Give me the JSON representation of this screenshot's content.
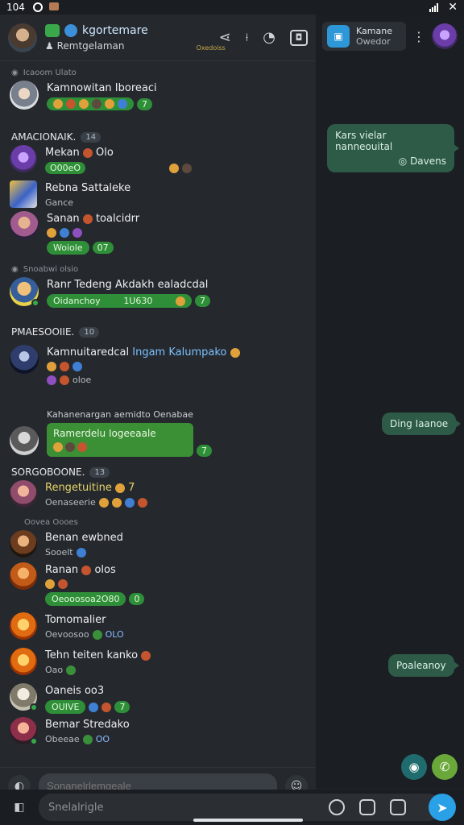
{
  "status": {
    "time": "104"
  },
  "header": {
    "title": "kgortemare",
    "subtitle": "Remtgelaman",
    "badge": "Oxedoiss"
  },
  "right_header": {
    "title": "Kamane",
    "subtitle": "Owedor"
  },
  "sections": {
    "pinned": "Icaoom Ulato",
    "a": "AMACIONAIK.",
    "a_count": "14",
    "pinned2": "Snoabwi olsio",
    "b": "PMAESOOIIE.",
    "b_count": "10",
    "c": "SORGOBOONE.",
    "c_count": "13",
    "members_online": "Oovea Oooes"
  },
  "rows": [
    {
      "name": "Kamnowitan Iboreaci",
      "chip": "7",
      "chip_text": "",
      "meta": ""
    },
    {
      "name": "Mekan",
      "name2": "Olo",
      "meta": "O00eO"
    },
    {
      "name": "Rebna Sattaleke",
      "meta": "Gance"
    },
    {
      "name": "Sanan",
      "name2": "toalcidrr",
      "chip": "07",
      "chip_text": "Woiole"
    },
    {
      "name": "Ranr Tedeng Akdakh ealadcdal",
      "chip": "7",
      "chip_text": "Oidanchoy",
      "chip_extra": "1U630"
    },
    {
      "name": "Kamnuitaredcal",
      "name_blue": "Ingam Kalumpako",
      "meta": "oloe"
    },
    {
      "name": "Kahanenargan aemidto Oenabae",
      "bubble": "Ramerdelu Iogeeaale",
      "chip": "7"
    },
    {
      "name": "Rengetuitine",
      "name2": "7",
      "meta": "Oenaseerie"
    },
    {
      "name": "Benan ewbned",
      "meta": "Sooelt"
    },
    {
      "name": "Ranan",
      "name2": "olos",
      "chip_text": "Oeooosoa2O80",
      "chip": "0"
    },
    {
      "name": "Tomomalier",
      "meta": "Oevoosoo",
      "meta2": "OLO"
    },
    {
      "name": "Tehn teiten kanko",
      "meta": "Oao"
    },
    {
      "name": "Oaneis oo3",
      "chip_text": "OUIVE",
      "chip": "7"
    },
    {
      "name": "Bemar Stredako",
      "meta": "Obeeae",
      "meta2": "OO"
    }
  ],
  "composer": {
    "placeholder": "Sonanelrlemgeale"
  },
  "bottom_input": {
    "placeholder": "Snelalrigle"
  },
  "right_bubbles": [
    {
      "line1": "Kars vielar nanneouital",
      "line2": "Davens"
    },
    {
      "line1": "Ding Iaanoe"
    },
    {
      "line1": "Poaleanoy"
    }
  ]
}
